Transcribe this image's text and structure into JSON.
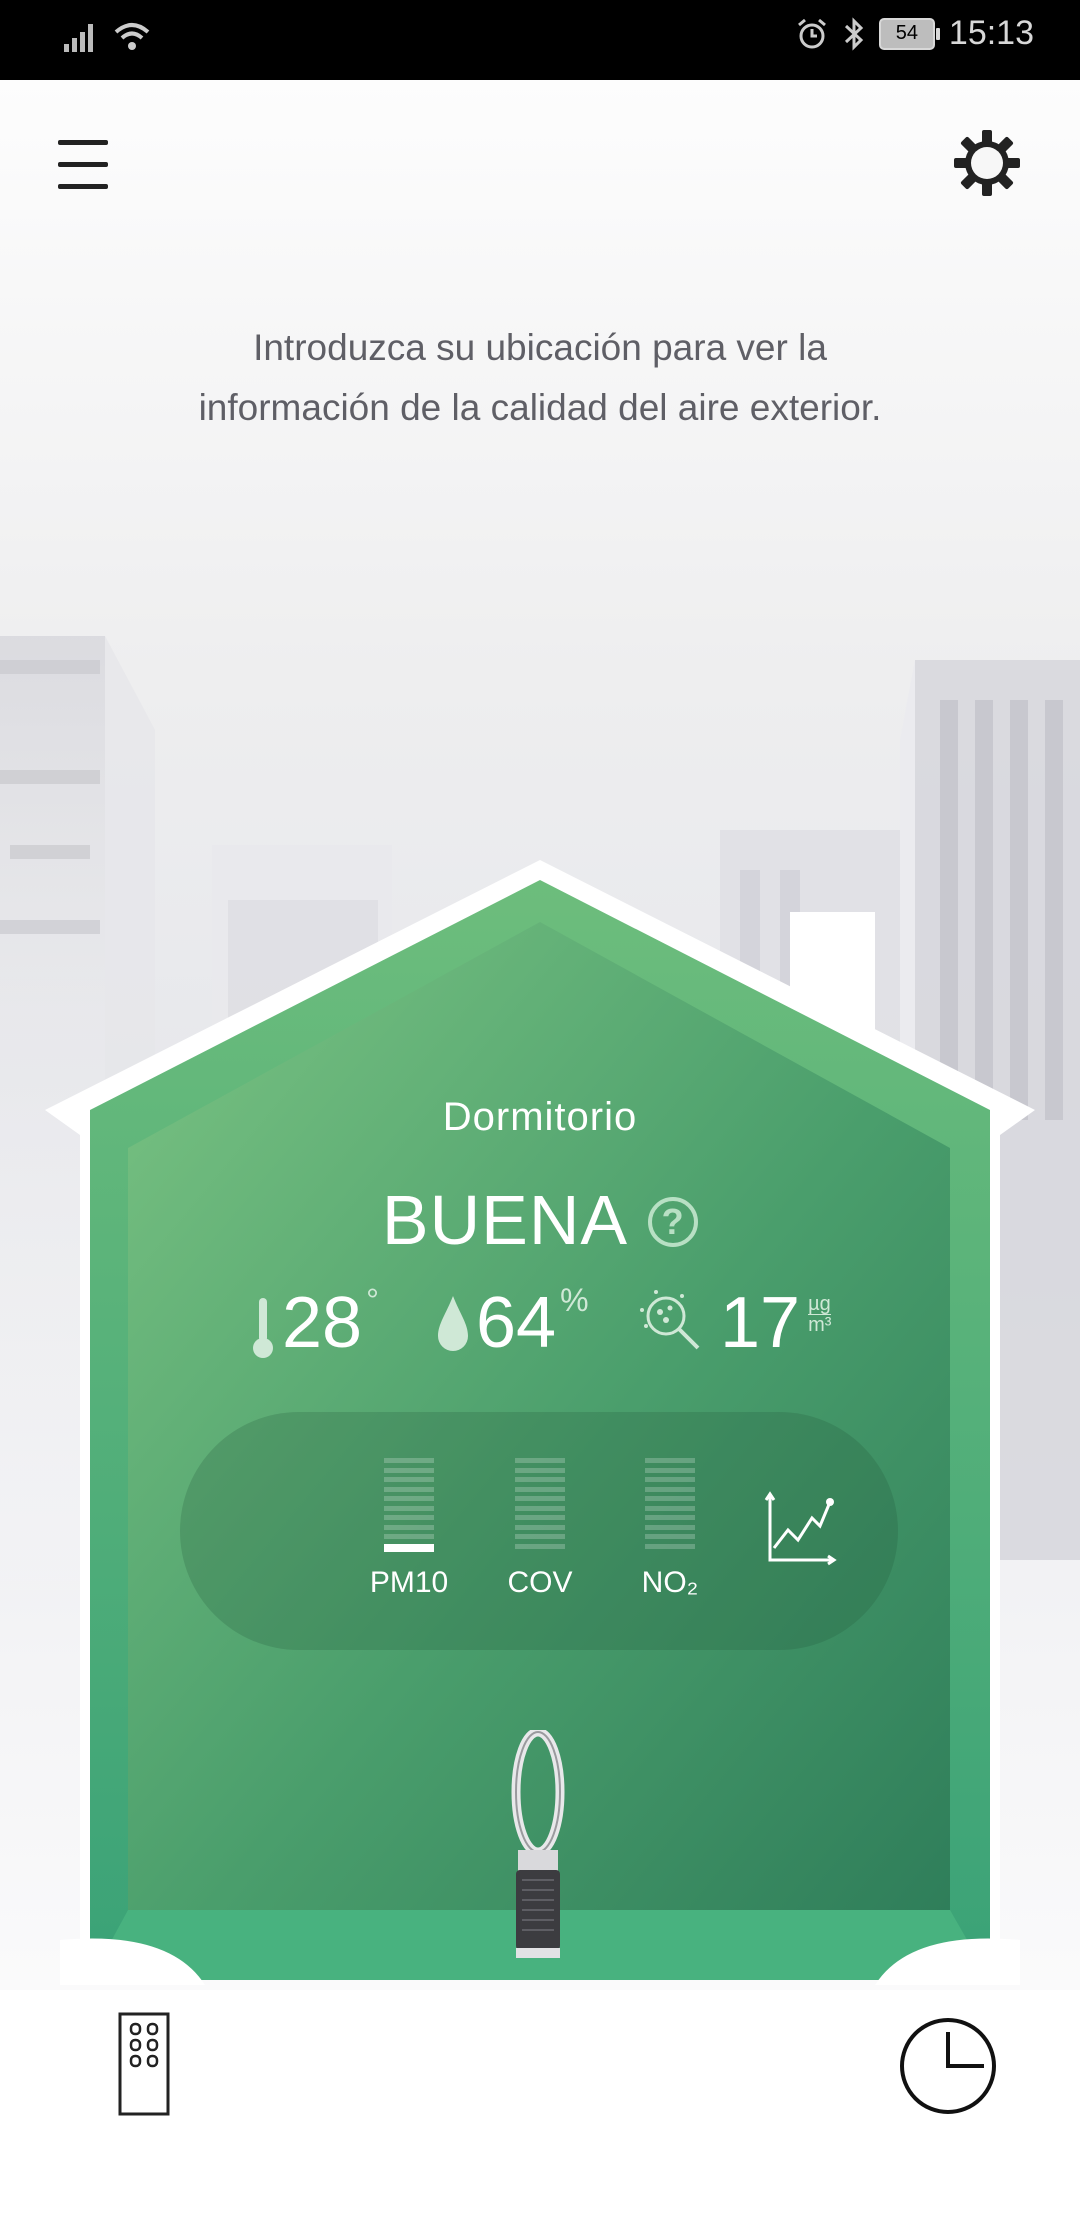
{
  "status_bar": {
    "battery": "54",
    "time": "15:13"
  },
  "intro_text": "Introduzca su ubicación para ver la información de la calidad del aire exterior.",
  "room": {
    "name": "Dormitorio",
    "air_quality": "BUENA"
  },
  "readings": {
    "temperature": {
      "value": "28",
      "unit": "°"
    },
    "humidity": {
      "value": "64",
      "unit": "%"
    },
    "particles": {
      "value": "17",
      "unit_top": "µg",
      "unit_bottom": "m³"
    }
  },
  "pollutants": [
    {
      "label": "PM10",
      "level": 0.1
    },
    {
      "label": "COV",
      "level": 0
    },
    {
      "label": "NO₂",
      "level": 0
    }
  ],
  "colors": {
    "house_green": "#5fb37a",
    "house_green_dark": "#2f7e5a",
    "accent_light": "#b8e0c4"
  },
  "icons": [
    "menu-icon",
    "settings-gear-icon",
    "thermometer-icon",
    "droplet-icon",
    "particle-search-icon",
    "line-chart-icon",
    "remote-control-icon",
    "clock-icon",
    "help-icon"
  ]
}
